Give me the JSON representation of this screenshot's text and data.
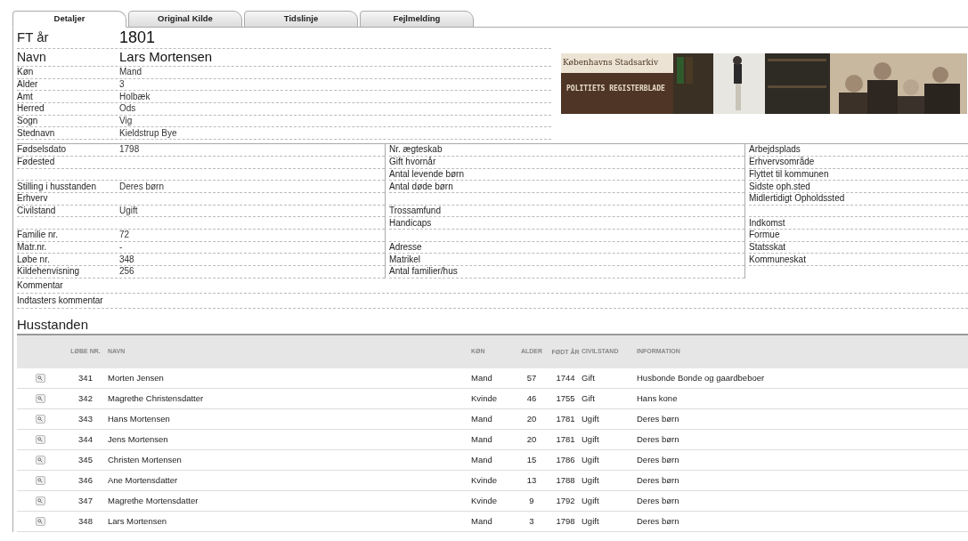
{
  "tabs": [
    {
      "label": "Detaljer",
      "selected": true
    },
    {
      "label": "Original Kilde",
      "selected": false
    },
    {
      "label": "Tidslinje",
      "selected": false
    },
    {
      "label": "Fejlmelding",
      "selected": false
    }
  ],
  "headline": [
    {
      "label": "FT år",
      "value": "1801"
    },
    {
      "label": "Navn",
      "value": "Lars Mortensen"
    }
  ],
  "summary": [
    {
      "label": "Køn",
      "value": "Mand"
    },
    {
      "label": "Alder",
      "value": "3"
    },
    {
      "label": "Amt",
      "value": "Holbæk"
    },
    {
      "label": "Herred",
      "value": "Ods"
    },
    {
      "label": "Sogn",
      "value": "Vig"
    },
    {
      "label": "Stednavn",
      "value": "Kieldstrup Bye"
    }
  ],
  "banner": {
    "title": "Københavns Stadsarkiv",
    "subtitle": "POLITIETS REGISTERBLADE"
  },
  "detail_columns": [
    [
      {
        "kind": "field",
        "label": "Fødselsdato",
        "value": "1798"
      },
      {
        "kind": "field",
        "label": "Fødested"
      },
      {
        "kind": "blank"
      },
      {
        "kind": "field",
        "label": "Stilling i husstanden",
        "value": "Deres børn"
      },
      {
        "kind": "field",
        "label": "Erhverv"
      },
      {
        "kind": "field",
        "label": "Civilstand",
        "value": "Ugift"
      },
      {
        "kind": "blank"
      },
      {
        "kind": "field",
        "label": "Familie nr.",
        "value": "72"
      },
      {
        "kind": "field",
        "label": "Matr.nr.",
        "value": "-"
      },
      {
        "kind": "field",
        "label": "Løbe nr.",
        "value": "348"
      },
      {
        "kind": "field",
        "label": "Kildehenvisning",
        "value": "256"
      }
    ],
    [
      {
        "kind": "field",
        "label": "Nr. ægteskab"
      },
      {
        "kind": "field",
        "label": "Gift hvornår"
      },
      {
        "kind": "field",
        "label": "Antal levende børn"
      },
      {
        "kind": "field",
        "label": "Antal døde børn"
      },
      {
        "kind": "blank"
      },
      {
        "kind": "field",
        "label": "Trossamfund"
      },
      {
        "kind": "field",
        "label": "Handicaps"
      },
      {
        "kind": "blank"
      },
      {
        "kind": "field",
        "label": "Adresse"
      },
      {
        "kind": "field",
        "label": "Matrikel"
      },
      {
        "kind": "field",
        "label": "Antal familier/hus"
      }
    ],
    [
      {
        "kind": "field",
        "label": "Arbejdsplads"
      },
      {
        "kind": "field",
        "label": "Erhvervsområde"
      },
      {
        "kind": "field",
        "label": "Flyttet til kommunen"
      },
      {
        "kind": "field",
        "label": "Sidste oph.sted"
      },
      {
        "kind": "field",
        "label": "Midlertidigt Opholdssted"
      },
      {
        "kind": "blank"
      },
      {
        "kind": "field",
        "label": "Indkomst"
      },
      {
        "kind": "field",
        "label": "Formue"
      },
      {
        "kind": "field",
        "label": "Statsskat"
      },
      {
        "kind": "field",
        "label": "Kommuneskat"
      }
    ]
  ],
  "comments": [
    {
      "label": "Kommentar"
    },
    {
      "label": "Indtasters kommentar"
    }
  ],
  "household": {
    "title": "Husstanden",
    "columns": [
      "LØBE NR.",
      "NAVN",
      "KØN",
      "ALDER",
      "FØDT ÅR",
      "CIVILSTAND",
      "INFORMATION"
    ],
    "rows": [
      [
        "341",
        "Morten Jensen",
        "Mand",
        "57",
        "1744",
        "Gift",
        "Husbonde Bonde og gaardbeboer"
      ],
      [
        "342",
        "Magrethe Christensdatter",
        "Kvinde",
        "46",
        "1755",
        "Gift",
        "Hans kone"
      ],
      [
        "343",
        "Hans Mortensen",
        "Mand",
        "20",
        "1781",
        "Ugift",
        "Deres børn"
      ],
      [
        "344",
        "Jens Mortensen",
        "Mand",
        "20",
        "1781",
        "Ugift",
        "Deres børn"
      ],
      [
        "345",
        "Christen Mortensen",
        "Mand",
        "15",
        "1786",
        "Ugift",
        "Deres børn"
      ],
      [
        "346",
        "Ane Mortensdatter",
        "Kvinde",
        "13",
        "1788",
        "Ugift",
        "Deres børn"
      ],
      [
        "347",
        "Magrethe Mortensdatter",
        "Kvinde",
        "9",
        "1792",
        "Ugift",
        "Deres børn"
      ],
      [
        "348",
        "Lars Mortensen",
        "Mand",
        "3",
        "1798",
        "Ugift",
        "Deres børn"
      ]
    ]
  }
}
